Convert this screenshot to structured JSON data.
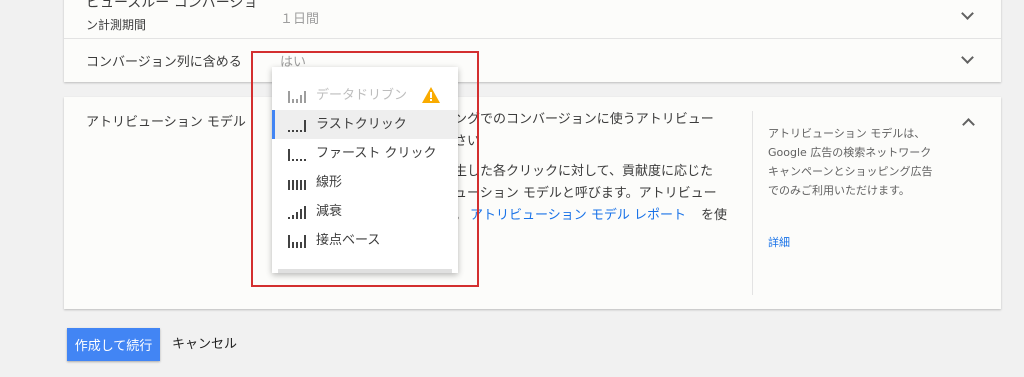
{
  "view_through_window": {
    "label_line1": "ビュースルー コンバージョ",
    "label_line2": "ン計測期間",
    "value": "１日間"
  },
  "include_in_conversions": {
    "label": "コンバージョン列に含める",
    "value": "はい"
  },
  "attribution_model": {
    "label": "アトリビューション モデル",
    "description_lines": [
      "ングでのコンバージョンに使うアトリビュー",
      "さい",
      "生した各クリックに対して、貢献度に応じた",
      "ューション モデルと呼びます。アトリビュー",
      "。"
    ],
    "report_link": "アトリビューション モデル レポート",
    "report_suffix": "を使",
    "help_text": "アトリビューション モデルは、Google 広告の検索ネットワーク キャンペーンとショッピング広告でのみご利用いただけます。",
    "help_link": "詳細"
  },
  "dropdown": {
    "items": [
      {
        "label": "データドリブン",
        "icon": "data-driven-icon",
        "disabled": true,
        "warning": true
      },
      {
        "label": "ラストクリック",
        "icon": "last-click-icon",
        "selected": true
      },
      {
        "label": "ファースト クリック",
        "icon": "first-click-icon"
      },
      {
        "label": "線形",
        "icon": "linear-icon"
      },
      {
        "label": "減衰",
        "icon": "time-decay-icon"
      },
      {
        "label": "接点ベース",
        "icon": "position-based-icon"
      }
    ]
  },
  "actions": {
    "create_label": "作成して続行",
    "cancel_label": "キャンセル"
  },
  "colors": {
    "accent": "#4285f4",
    "highlight": "#d32f2f",
    "warning": "#f9ab00",
    "link": "#1a73e8"
  }
}
